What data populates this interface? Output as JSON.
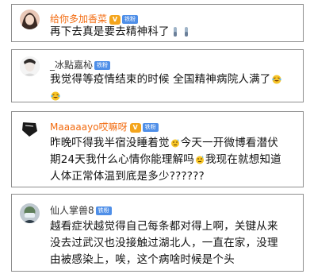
{
  "comments": [
    {
      "username": "给你多加香菜",
      "vip_badge": "V",
      "fan_badge": "铁粉",
      "text": "再下去真是要去精神科了",
      "emojis": [
        "test-tube-icon",
        "test-tube-icon"
      ]
    },
    {
      "username": "_冰點嘉杺",
      "fan_badge": "铁粉",
      "text_lines": [
        "我觉得等疫情结束的时候 全国精神病院人满了",
        ""
      ],
      "emojis": [
        "laughing-crying-icon",
        "laughing-crying-icon"
      ]
    },
    {
      "username": "Maaaaayo哎嘛呀",
      "vip_badge": "V",
      "fan_badge": "铁粉",
      "text_lines": [
        "昨晚吓得我半宿没睡着觉",
        "今天一开微博看潜伏",
        "期24天我什么心情你能理解吗",
        "我现在就想知道",
        "人体正常体温到底是多少??????"
      ],
      "emojis": [
        "sweat-icon",
        "sweat-icon"
      ]
    },
    {
      "username": "仙人掌兽8",
      "fan_badge": "铁粉",
      "text_lines": [
        "越看症状越觉得自己每条都对得上啊，关键从来",
        "没去过武汉也没接触过湖北人，一直在家，没理",
        "由被感染上，唉，这个病啥时候是个头"
      ]
    }
  ],
  "colors": {
    "orange_name": "#f26b10",
    "dark_name": "#333333",
    "vip": "#f4a51c",
    "fan": "#4f8fe8",
    "border": "#8e8e8e"
  }
}
